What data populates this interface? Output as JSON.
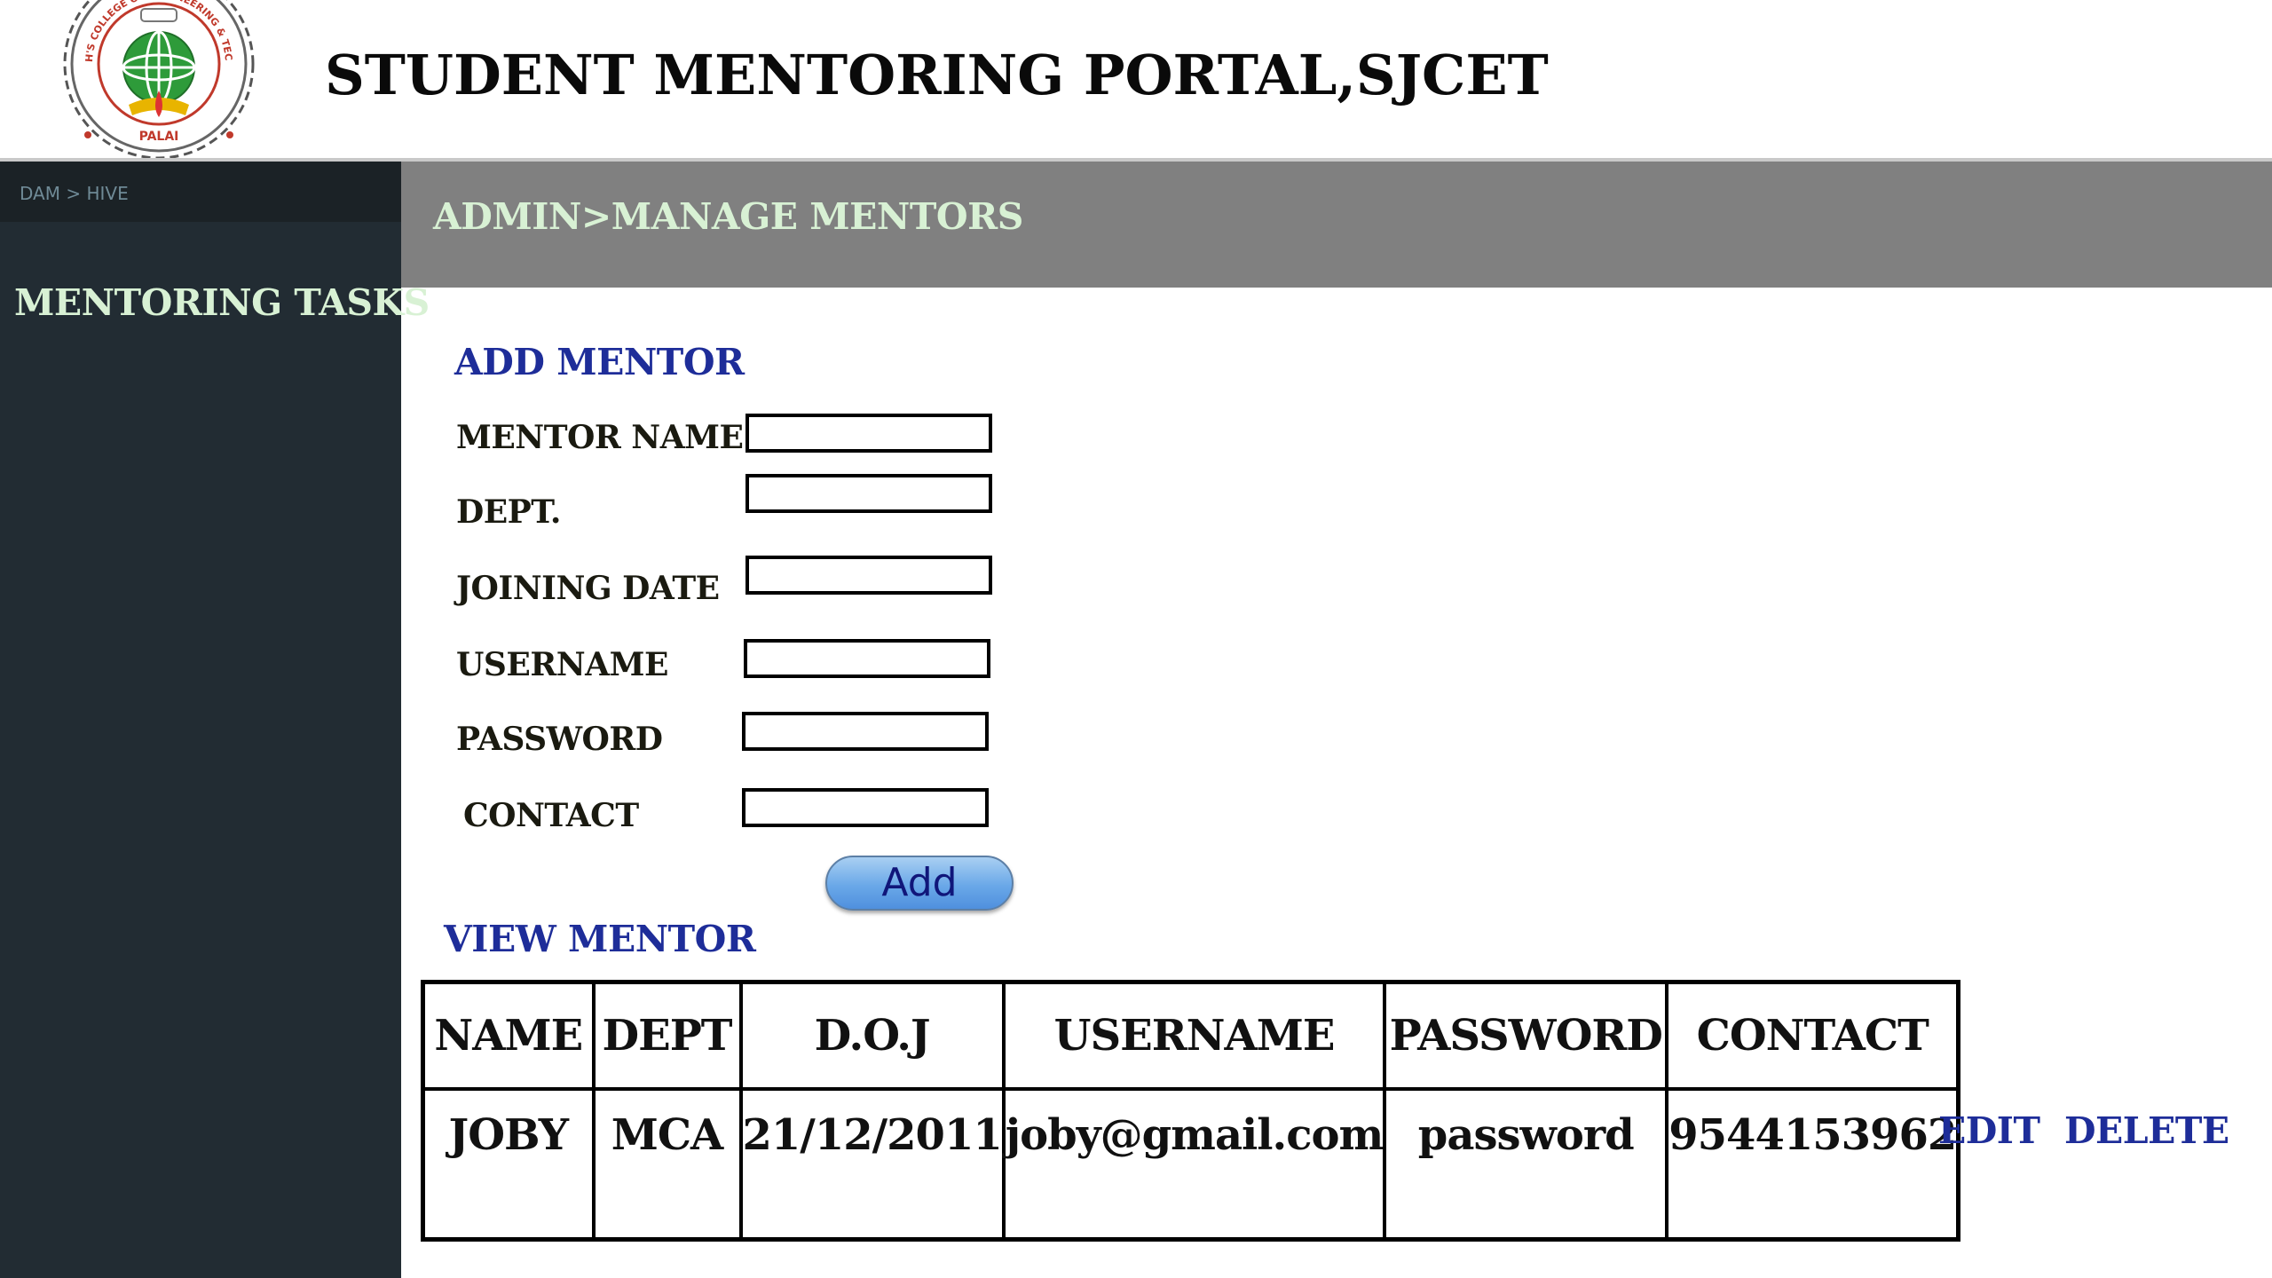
{
  "header": {
    "title": "STUDENT MENTORING PORTAL,SJCET",
    "logo": {
      "ring_top": "ST. JOSEPH'S COLLEGE OF ENGINEERING & TECHNOLOGY",
      "ring_bottom": "PALAI",
      "icon": "college-seal-globe-icon"
    }
  },
  "sidebar": {
    "breadcrumb": "DAM > HIVE",
    "title": "MENTORING TASKS"
  },
  "banner": {
    "text": "ADMIN>MANAGE MENTORS"
  },
  "add_mentor": {
    "heading": "ADD MENTOR",
    "fields": {
      "mentor_name": {
        "label": "MENTOR NAME",
        "value": ""
      },
      "dept": {
        "label": "DEPT.",
        "value": ""
      },
      "joining_date": {
        "label": "JOINING DATE",
        "value": ""
      },
      "username": {
        "label": "USERNAME",
        "value": ""
      },
      "password": {
        "label": "PASSWORD",
        "value": ""
      },
      "contact": {
        "label": "CONTACT",
        "value": ""
      }
    },
    "add_button": "Add"
  },
  "view_mentor": {
    "heading": "VIEW MENTOR",
    "columns": [
      "NAME",
      "DEPT",
      "D.O.J",
      "USERNAME",
      "PASSWORD",
      "CONTACT"
    ],
    "rows": [
      {
        "name": "JOBY",
        "dept": "MCA",
        "doj": "21/12/2011",
        "username": "joby@gmail.com",
        "password": "password",
        "contact": "9544153962"
      }
    ],
    "actions": {
      "edit": "EDIT",
      "delete": "DELETE"
    }
  },
  "colors": {
    "sidebar_bg": "#222c33",
    "banner_bg": "#808080",
    "heading_blue": "#1e2d99",
    "mint_text": "#d8f1d4"
  }
}
